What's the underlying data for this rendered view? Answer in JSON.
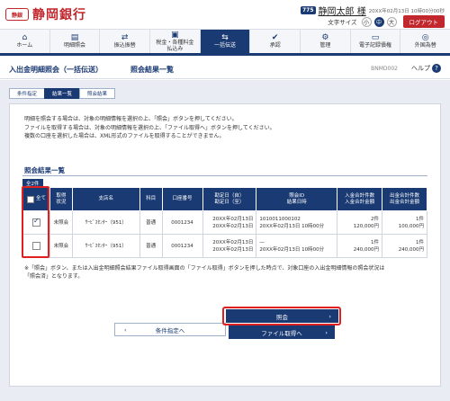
{
  "header": {
    "logo_mark": "静銀",
    "bank_name": "静岡銀行",
    "user_badge": "775",
    "user_name": "静岡太郎 様",
    "login_time": "20XX年02月13日 10時00分00秒",
    "font_size_label": "文字サイズ",
    "font_sizes": [
      "小",
      "中",
      "大"
    ],
    "logout_label": "ログアウト"
  },
  "gnav": {
    "items": [
      {
        "icon": "⌂",
        "label": "ホーム"
      },
      {
        "icon": "▤",
        "label": "明細照会"
      },
      {
        "icon": "⇄",
        "label": "振込振替"
      },
      {
        "icon": "▣",
        "label": "税金・各種料金\n払込み"
      },
      {
        "icon": "⇆",
        "label": "一括伝送"
      },
      {
        "icon": "✔",
        "label": "承認"
      },
      {
        "icon": "⚙",
        "label": "管理"
      },
      {
        "icon": "▭",
        "label": "電子記録債権"
      },
      {
        "icon": "◎",
        "label": "外国為替"
      }
    ]
  },
  "page": {
    "title": "入出金明細照会（一括伝送）",
    "subtitle": "照会結果一覧",
    "screen_id": "BNMD002",
    "help_label": "ヘルプ"
  },
  "steps": [
    "条件指定",
    "結果一覧",
    "照会結果"
  ],
  "instructions": [
    "明細を照会する場合は、対象の明細情報を選択の上、「照会」ボタンを押してください。",
    "ファイルを取得する場合は、対象の明細情報を選択の上、「ファイル取得へ」ボタンを押してください。",
    "複数の口座を選択した場合は、XML形式のファイルを取得することができません。"
  ],
  "results": {
    "section_title": "照会結果一覧",
    "count": "全2件",
    "headers": {
      "select_all": "全て",
      "status": "取得\n状況",
      "branch": "支店名",
      "type": "科目",
      "account": "口座番号",
      "period": "勘定日（自）\n勘定日（至）",
      "inquiry_id": "照会ID\n結果日時",
      "deposit": "入金合計件数\n入金合計金額",
      "withdrawal": "出金合計件数\n出金合計金額"
    },
    "rows": [
      {
        "checked": true,
        "status": "未照会",
        "branch": "ｻｰﾋﾞｽｾﾝﾀｰ（951）",
        "type": "普通",
        "account": "0001234",
        "period_from": "20XX年02月13日",
        "period_to": "20XX年02月13日",
        "inquiry_id": "1010011000102",
        "result_time": "20XX年02月13日 10時00分",
        "deposit_count": "2件",
        "deposit_amount": "120,000円",
        "withdrawal_count": "1件",
        "withdrawal_amount": "100,000円"
      },
      {
        "checked": false,
        "status": "未照会",
        "branch": "ｻｰﾋﾞｽｾﾝﾀｰ（951）",
        "type": "普通",
        "account": "0001234",
        "period_from": "20XX年02月13日",
        "period_to": "20XX年02月13日",
        "inquiry_id": "―",
        "result_time": "20XX年02月13日 10時00分",
        "deposit_count": "1件",
        "deposit_amount": "240,000円",
        "withdrawal_count": "1件",
        "withdrawal_amount": "240,000円"
      }
    ]
  },
  "note": [
    "※「照会」ボタン、または入出金明細照会結果ファイル取得画面の「ファイル取得」ボタンを押した時点で、対象口座の入出金明細情報の照会状況は",
    "「照会済」となります。"
  ],
  "buttons": {
    "back": "条件指定へ",
    "inquiry": "照会",
    "file": "ファイル取得へ"
  }
}
